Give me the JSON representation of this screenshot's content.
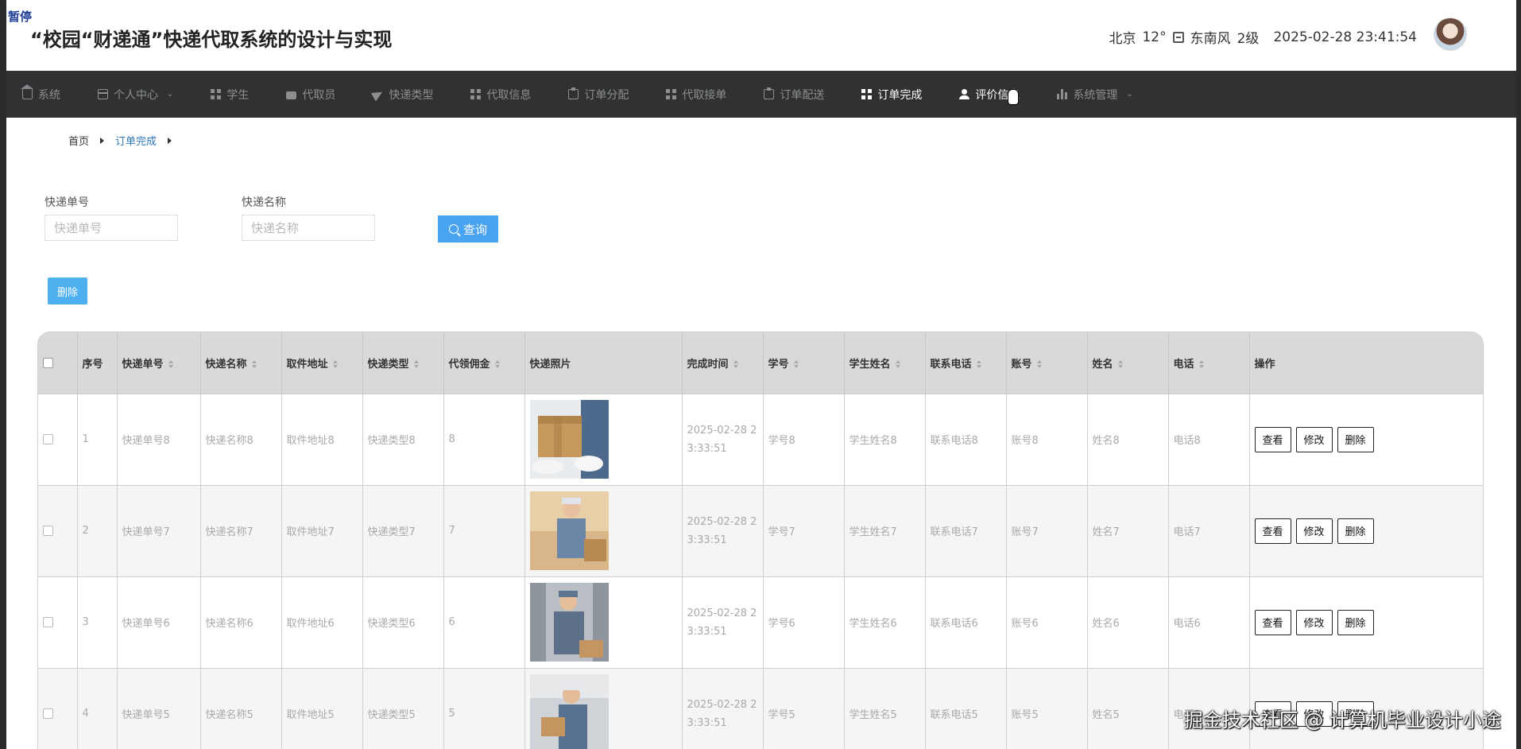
{
  "pause_tag": "暂停",
  "header": {
    "title": "“校园“财递通”快递代取系统的设计与实现",
    "weather": {
      "city": "北京",
      "temp": "12°",
      "wind": "东南风",
      "level": "2级"
    },
    "datetime": "2025-02-28 23:41:54"
  },
  "nav": {
    "items": [
      {
        "label": "系统",
        "icon": "home-icon"
      },
      {
        "label": "个人中心",
        "icon": "card-icon",
        "dropdown": true
      },
      {
        "label": "学生",
        "icon": "grid-icon"
      },
      {
        "label": "代取员",
        "icon": "truck-icon"
      },
      {
        "label": "快递类型",
        "icon": "paper-plane-icon"
      },
      {
        "label": "代取信息",
        "icon": "grid-icon"
      },
      {
        "label": "订单分配",
        "icon": "clipboard-icon"
      },
      {
        "label": "代取接单",
        "icon": "grid-icon"
      },
      {
        "label": "订单配送",
        "icon": "clipboard-icon"
      },
      {
        "label": "订单完成",
        "icon": "grid-icon",
        "active": true
      },
      {
        "label": "评价信息",
        "icon": "user-icon",
        "active": true
      },
      {
        "label": "系统管理",
        "icon": "bar-chart-icon",
        "dropdown": true
      }
    ],
    "colors": {
      "bg": "#2f3132",
      "inactive": "#8c8e90",
      "active": "#ffffff"
    }
  },
  "breadcrumb": {
    "home": "首页",
    "current": "订单完成"
  },
  "search": {
    "field1": {
      "label": "快递单号",
      "placeholder": "快递单号"
    },
    "field2": {
      "label": "快递名称",
      "placeholder": "快递名称"
    },
    "query_label": "查询"
  },
  "delete_label": "删除",
  "table": {
    "headers": [
      "序号",
      "快递单号",
      "快递名称",
      "取件地址",
      "快递类型",
      "代领佣金",
      "快递照片",
      "完成时间",
      "学号",
      "学生姓名",
      "联系电话",
      "账号",
      "姓名",
      "电话",
      "操作"
    ],
    "rows": [
      {
        "index": "1",
        "no": "快递单号8",
        "name": "快递名称8",
        "addr": "取件地址8",
        "type": "快递类型8",
        "fee": "8",
        "time": "2025-02-28 23:33:51",
        "sid": "学号8",
        "sname": "学生姓名8",
        "contact": "联系电话8",
        "account": "账号8",
        "pname": "姓名8",
        "phone": "电话8"
      },
      {
        "index": "2",
        "no": "快递单号7",
        "name": "快递名称7",
        "addr": "取件地址7",
        "type": "快递类型7",
        "fee": "7",
        "time": "2025-02-28 23:33:51",
        "sid": "学号7",
        "sname": "学生姓名7",
        "contact": "联系电话7",
        "account": "账号7",
        "pname": "姓名7",
        "phone": "电话7"
      },
      {
        "index": "3",
        "no": "快递单号6",
        "name": "快递名称6",
        "addr": "取件地址6",
        "type": "快递类型6",
        "fee": "6",
        "time": "2025-02-28 23:33:51",
        "sid": "学号6",
        "sname": "学生姓名6",
        "contact": "联系电话6",
        "account": "账号6",
        "pname": "姓名6",
        "phone": "电话6"
      },
      {
        "index": "4",
        "no": "快递单号5",
        "name": "快递名称5",
        "addr": "取件地址5",
        "type": "快递类型5",
        "fee": "5",
        "time": "2025-02-28 23:33:51",
        "sid": "学号5",
        "sname": "学生姓名5",
        "contact": "联系电话5",
        "account": "账号5",
        "pname": "姓名5",
        "phone": "电话5"
      }
    ],
    "ops": {
      "view": "查看",
      "edit": "修改",
      "delete": "删除"
    }
  },
  "watermark": "掘金技术社区 @ 计算机毕业设计小途",
  "accent_colors": {
    "primary_button": "#4aa3f0",
    "breadcrumb_active": "#2f77b8"
  }
}
